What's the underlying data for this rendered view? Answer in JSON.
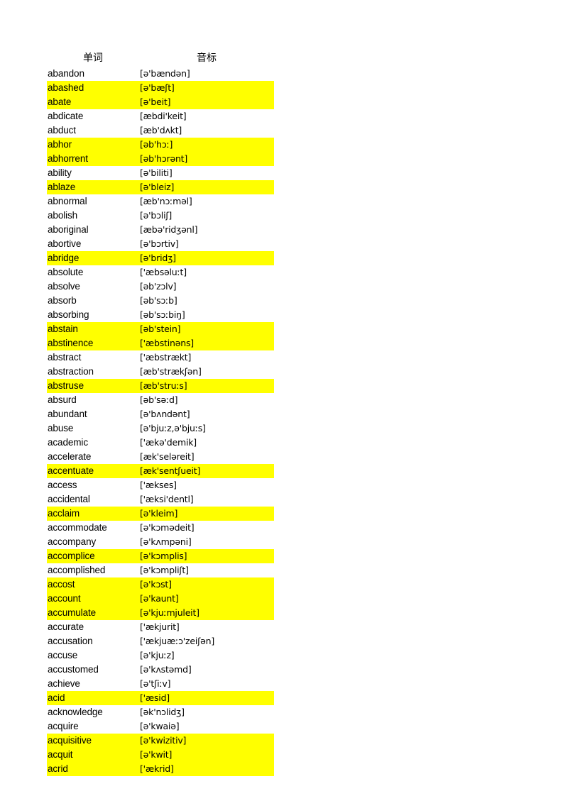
{
  "table": {
    "headers": {
      "word": "单词",
      "ipa": "音标"
    },
    "highlight_color": "#ffff00",
    "rows": [
      {
        "word": "abandon",
        "ipa": "[ə'bændən]",
        "highlighted": false
      },
      {
        "word": "abashed",
        "ipa": "[ə'bæʃt]",
        "highlighted": true
      },
      {
        "word": "abate",
        "ipa": "[ə'beit]",
        "highlighted": true
      },
      {
        "word": "abdicate",
        "ipa": "[æbdi'keit]",
        "highlighted": false
      },
      {
        "word": "abduct",
        "ipa": "[æb'dʌkt]",
        "highlighted": false
      },
      {
        "word": "abhor",
        "ipa": "[əb'hɔː]",
        "highlighted": true
      },
      {
        "word": "abhorrent",
        "ipa": "[əb'hɔrənt]",
        "highlighted": true
      },
      {
        "word": "ability",
        "ipa": "[ə'biliti]",
        "highlighted": false
      },
      {
        "word": "ablaze",
        "ipa": "[ə'bleiz]",
        "highlighted": true
      },
      {
        "word": "abnormal",
        "ipa": "[æb'nɔːməl]",
        "highlighted": false
      },
      {
        "word": "abolish",
        "ipa": "[ə'bɔliʃ]",
        "highlighted": false
      },
      {
        "word": "aboriginal",
        "ipa": "[æbə'ridʒənl]",
        "highlighted": false
      },
      {
        "word": "abortive",
        "ipa": "[ə'bɔrtiv]",
        "highlighted": false
      },
      {
        "word": "abridge",
        "ipa": "[ə'bridʒ]",
        "highlighted": true
      },
      {
        "word": "absolute",
        "ipa": "['æbsəluːt]",
        "highlighted": false
      },
      {
        "word": "absolve",
        "ipa": "[əb'zɔlv]",
        "highlighted": false
      },
      {
        "word": "absorb",
        "ipa": "[əb'sɔːb]",
        "highlighted": false
      },
      {
        "word": "absorbing",
        "ipa": "[əb'sɔːbiŋ]",
        "highlighted": false
      },
      {
        "word": "abstain",
        "ipa": "[əb'stein]",
        "highlighted": true
      },
      {
        "word": "abstinence",
        "ipa": "['æbstinəns]",
        "highlighted": true
      },
      {
        "word": "abstract",
        "ipa": "['æbstrækt]",
        "highlighted": false
      },
      {
        "word": "abstraction",
        "ipa": "[æb'strækʃən]",
        "highlighted": false
      },
      {
        "word": "abstruse",
        "ipa": "[æb'struːs]",
        "highlighted": true
      },
      {
        "word": "absurd",
        "ipa": "[əb'səːd]",
        "highlighted": false
      },
      {
        "word": "abundant",
        "ipa": "[ə'bʌndənt]",
        "highlighted": false
      },
      {
        "word": "abuse",
        "ipa": "[ə'bjuːz,ə'bjuːs]",
        "highlighted": false
      },
      {
        "word": "academic",
        "ipa": "['ækə'demik]",
        "highlighted": false
      },
      {
        "word": "accelerate",
        "ipa": "[æk'seləreit]",
        "highlighted": false
      },
      {
        "word": "accentuate",
        "ipa": "[æk'sentʃueit]",
        "highlighted": true
      },
      {
        "word": "access",
        "ipa": "['ækses]",
        "highlighted": false
      },
      {
        "word": "accidental",
        "ipa": "['æksi'dentl]",
        "highlighted": false
      },
      {
        "word": "acclaim",
        "ipa": "[ə'kleim]",
        "highlighted": true
      },
      {
        "word": "accommodate",
        "ipa": "[ə'kɔmədeit]",
        "highlighted": false
      },
      {
        "word": "accompany",
        "ipa": "[ə'kʌmpəni]",
        "highlighted": false
      },
      {
        "word": "accomplice",
        "ipa": "[ə'kɔmplis]",
        "highlighted": true
      },
      {
        "word": "accomplished",
        "ipa": "[ə'kɔmpliʃt]",
        "highlighted": false
      },
      {
        "word": "accost",
        "ipa": "[ə'kɔst]",
        "highlighted": true
      },
      {
        "word": "account",
        "ipa": "[ə'kaunt]",
        "highlighted": true
      },
      {
        "word": "accumulate",
        "ipa": "[ə'kjuːmjuleit]",
        "highlighted": true
      },
      {
        "word": "accurate",
        "ipa": "['ækjurit]",
        "highlighted": false
      },
      {
        "word": "accusation",
        "ipa": "['ækjuæːɔ'zeiʃən]",
        "highlighted": false
      },
      {
        "word": "accuse",
        "ipa": "[ə'kjuːz]",
        "highlighted": false
      },
      {
        "word": "accustomed",
        "ipa": "[ə'kʌstəmd]",
        "highlighted": false
      },
      {
        "word": "achieve",
        "ipa": "[ə'tʃiːv]",
        "highlighted": false
      },
      {
        "word": "acid",
        "ipa": "['æsid]",
        "highlighted": true
      },
      {
        "word": "acknowledge",
        "ipa": "[ək'nɔlidʒ]",
        "highlighted": false
      },
      {
        "word": "acquire",
        "ipa": "[ə'kwaiə]",
        "highlighted": false
      },
      {
        "word": "acquisitive",
        "ipa": "[ə'kwizitiv]",
        "highlighted": true
      },
      {
        "word": "acquit",
        "ipa": "[ə'kwit]",
        "highlighted": true
      },
      {
        "word": "acrid",
        "ipa": "['ækrid]",
        "highlighted": true
      }
    ]
  }
}
